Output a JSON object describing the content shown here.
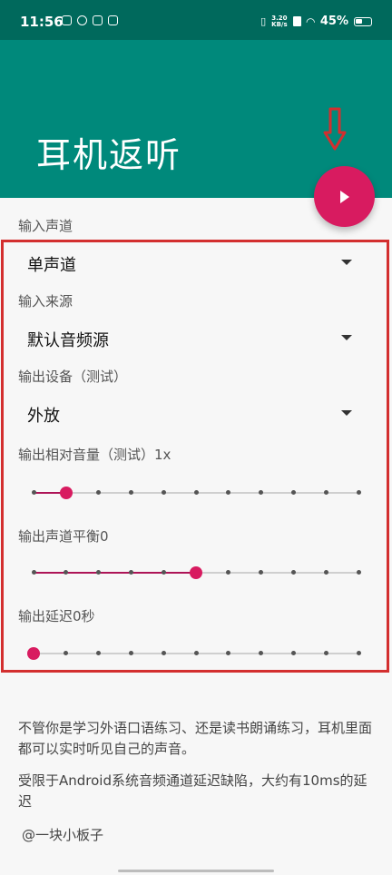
{
  "status_bar": {
    "time": "11:56",
    "net_speed_value": "3.20",
    "net_speed_unit": "KB/s",
    "battery": "45%"
  },
  "app_bar": {
    "title": "耳机返听"
  },
  "fab": {
    "icon": "play-icon"
  },
  "input_channel": {
    "label": "输入声道",
    "value": "单声道"
  },
  "input_source": {
    "label": "输入来源",
    "value": "默认音频源"
  },
  "output_device": {
    "label": "输出设备（测试）",
    "value": "外放"
  },
  "relative_volume": {
    "label": "输出相对音量（测试）1x",
    "level": 0.1,
    "steps": 10
  },
  "channel_balance": {
    "label": "输出声道平衡0",
    "level": 0.5,
    "steps": 10
  },
  "output_delay": {
    "label": "输出延迟0秒",
    "level": 0.0,
    "steps": 10
  },
  "description": {
    "para1": "不管你是学习外语口语练习、还是读书朗诵练习，耳机里面都可以实时听见自己的声音。",
    "para2": "受限于Android系统音频通道延迟缺陷，大约有10ms的延迟",
    "author": "@一块小板子"
  },
  "colors": {
    "appbar": "#00897b",
    "statusbar": "#00695c",
    "accent": "#d81b60",
    "highlight_box": "#d32f2f"
  }
}
